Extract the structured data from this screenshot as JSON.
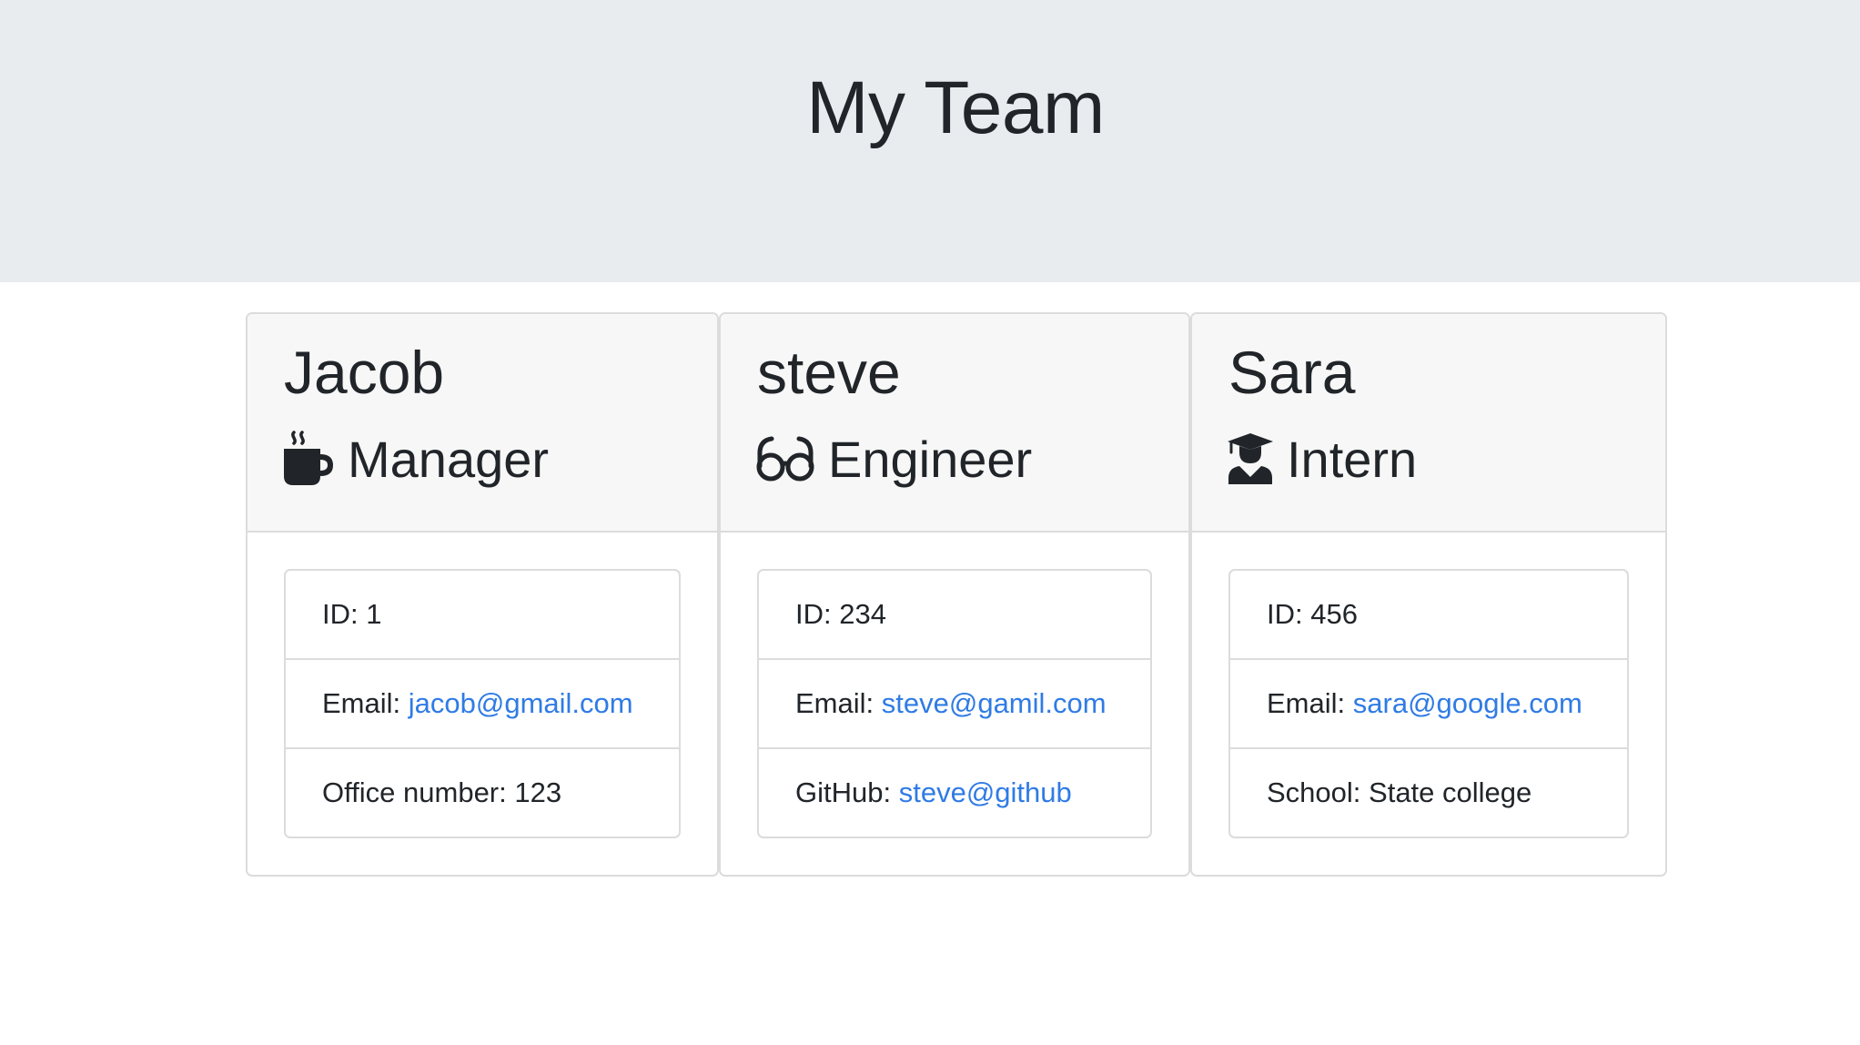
{
  "header": {
    "title": "My Team",
    "background": "#e9ecef"
  },
  "colors": {
    "link": "#2f7be5",
    "text": "#212529",
    "card_header_bg": "#f7f7f7",
    "border": "#dcdcdc"
  },
  "cards": [
    {
      "name": "Jacob",
      "role": "Manager",
      "role_icon": "coffee-mug-icon",
      "id_label": "ID:",
      "id_value": "1",
      "email_label": "Email:",
      "email_value": "jacob@gmail.com",
      "extra_label": "Office number:",
      "extra_value": "123",
      "extra_is_link": false
    },
    {
      "name": "steve",
      "role": "Engineer",
      "role_icon": "glasses-icon",
      "id_label": "ID:",
      "id_value": "234",
      "email_label": "Email:",
      "email_value": "steve@gamil.com",
      "extra_label": "GitHub:",
      "extra_value": "steve@github",
      "extra_is_link": true
    },
    {
      "name": "Sara",
      "role": "Intern",
      "role_icon": "graduate-student-icon",
      "id_label": "ID:",
      "id_value": "456",
      "email_label": "Email:",
      "email_value": "sara@google.com",
      "extra_label": "School:",
      "extra_value": "State college",
      "extra_is_link": false
    }
  ]
}
